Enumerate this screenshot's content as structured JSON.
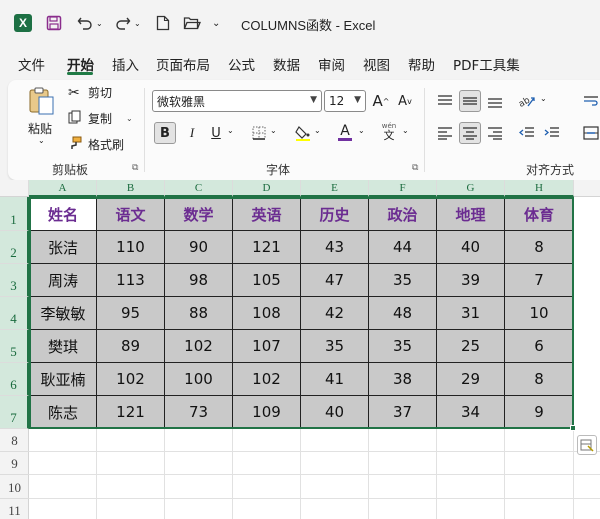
{
  "window": {
    "app_logo": "X",
    "title": "COLUMNS函数  -  Excel"
  },
  "menu": {
    "tabs": [
      "文件",
      "开始",
      "插入",
      "页面布局",
      "公式",
      "数据",
      "审阅",
      "视图",
      "帮助",
      "PDF工具集"
    ],
    "active": "开始"
  },
  "ribbon": {
    "clipboard": {
      "paste_label": "粘贴",
      "cut_label": "剪切",
      "copy_label": "复制",
      "format_painter_label": "格式刷",
      "group_label": "剪贴板"
    },
    "font": {
      "font_name": "微软雅黑",
      "font_size": "12",
      "bold": "B",
      "italic": "I",
      "underline": "U",
      "font_color_glyph": "A",
      "phonetic_top": "wén",
      "phonetic_bottom": "文",
      "grow_glyph": "A",
      "shrink_glyph": "A",
      "group_label": "字体"
    },
    "alignment": {
      "group_label": "对齐方式"
    },
    "colors": {
      "accent": "#217346",
      "font_color_bar": "#7030a0",
      "fill_color_bar": "#ffff00"
    }
  },
  "sheet": {
    "columns": [
      "A",
      "B",
      "C",
      "D",
      "E",
      "F",
      "G",
      "H"
    ],
    "rows": [
      "1",
      "2",
      "3",
      "4",
      "5",
      "6",
      "7",
      "8",
      "9",
      "10",
      "11"
    ],
    "header": [
      "姓名",
      "语文",
      "数学",
      "英语",
      "历史",
      "政治",
      "地理",
      "体育"
    ],
    "data": [
      [
        "张洁",
        "110",
        "90",
        "121",
        "43",
        "44",
        "40",
        "8"
      ],
      [
        "周涛",
        "113",
        "98",
        "105",
        "47",
        "35",
        "39",
        "7"
      ],
      [
        "李敏敏",
        "95",
        "88",
        "108",
        "42",
        "48",
        "31",
        "10"
      ],
      [
        "樊琪",
        "89",
        "102",
        "107",
        "35",
        "35",
        "25",
        "6"
      ],
      [
        "耿亚楠",
        "102",
        "100",
        "102",
        "41",
        "38",
        "29",
        "8"
      ],
      [
        "陈志",
        "121",
        "73",
        "109",
        "40",
        "37",
        "34",
        "9"
      ]
    ],
    "header_text_color": "#6b2c91",
    "cell_fill_color": "#c9c9c9"
  }
}
